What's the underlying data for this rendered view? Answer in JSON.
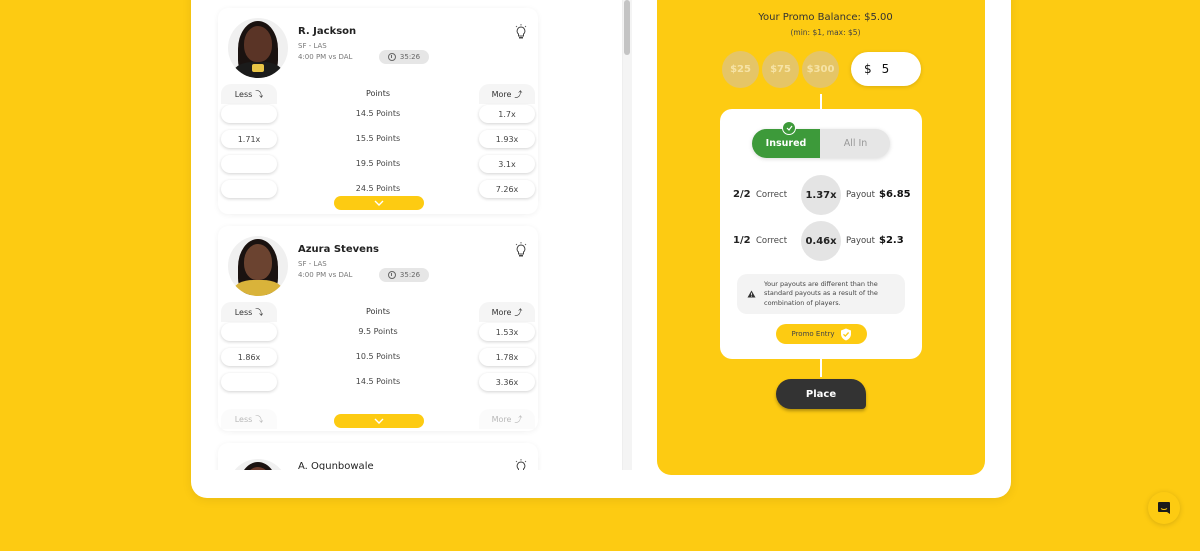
{
  "picks": [
    {
      "name": "R. Jackson",
      "team": "SF - LAS",
      "game_time": "4:00 PM vs DAL",
      "timer": "35:26",
      "less_label": "Less",
      "more_label": "More",
      "stat_label": "Points",
      "lines": [
        {
          "line": "14.5 Points",
          "less": "",
          "more": "1.7x"
        },
        {
          "line": "15.5 Points",
          "less": "1.71x",
          "more": "1.93x"
        },
        {
          "line": "19.5 Points",
          "less": "",
          "more": "3.1x"
        },
        {
          "line": "24.5 Points",
          "less": "",
          "more": "7.26x"
        }
      ]
    },
    {
      "name": "Azura Stevens",
      "team": "SF - LAS",
      "game_time": "4:00 PM vs DAL",
      "timer": "35:26",
      "less_label": "Less",
      "more_label": "More",
      "stat_label": "Points",
      "lines": [
        {
          "line": "9.5 Points",
          "less": "",
          "more": "1.53x"
        },
        {
          "line": "10.5 Points",
          "less": "1.86x",
          "more": "1.78x"
        },
        {
          "line": "14.5 Points",
          "less": "",
          "more": "3.36x"
        }
      ]
    },
    {
      "name": "A. Ogunbowale"
    }
  ],
  "bet_slip": {
    "promo_balance": "Your Promo Balance: $5.00",
    "limits": "(min: $1, max: $5)",
    "chips": [
      "$25",
      "$75",
      "$300"
    ],
    "currency_symbol": "$",
    "amount": "5",
    "modes": {
      "insured": "Insured",
      "all_in": "All In",
      "selected": "Insured"
    },
    "payouts": [
      {
        "fraction": "2/2",
        "correct_label": "Correct",
        "multiplier": "1.37x",
        "payout_label": "Payout",
        "payout": "$6.85"
      },
      {
        "fraction": "1/2",
        "correct_label": "Correct",
        "multiplier": "0.46x",
        "payout_label": "Payout",
        "payout": "$2.3"
      }
    ],
    "notice": "Your payouts are different than the standard payouts as a result of the combination of players.",
    "promo_entry_label": "Promo Entry",
    "place_label": "Place"
  },
  "colors": {
    "brand_yellow": "#fdcb12",
    "insured_green": "#3d9a3a",
    "place_dark": "#333333"
  }
}
